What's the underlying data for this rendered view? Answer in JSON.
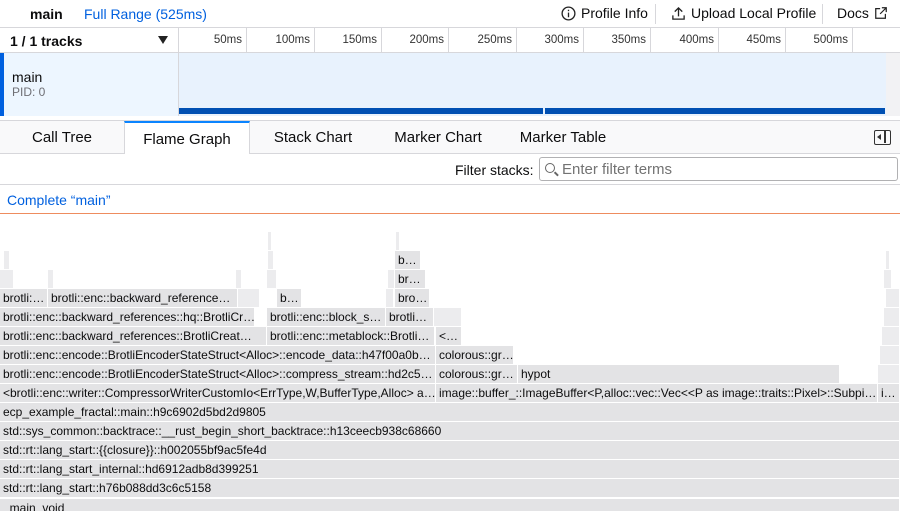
{
  "topbar": {
    "root_crumb": "main",
    "range_crumb": "Full Range (525ms)",
    "profile_info": "Profile Info",
    "upload": "Upload Local Profile",
    "docs": "Docs"
  },
  "timeline": {
    "tracks_label": "1 / 1 tracks",
    "ticks": [
      "50ms",
      "100ms",
      "150ms",
      "200ms",
      "250ms",
      "300ms",
      "350ms",
      "400ms",
      "450ms",
      "500ms"
    ],
    "track": {
      "name": "main",
      "pid": "PID: 0"
    }
  },
  "tabs": [
    "Call Tree",
    "Flame Graph",
    "Stack Chart",
    "Marker Chart",
    "Marker Table"
  ],
  "active_tab": "Flame Graph",
  "filter": {
    "label": "Filter stacks:",
    "placeholder": "Enter filter terms"
  },
  "breadcrumb": "Complete “main”",
  "flame": {
    "rows": [
      [
        "_main_void"
      ],
      [
        "std::rt::lang_start::h76b088dd3c6c5158"
      ],
      [
        "std::rt::lang_start_internal::hd6912adb8d399251"
      ],
      [
        "std::rt::lang_start::{{closure}}::h002055bf9ac5fe4d"
      ],
      [
        "std::sys_common::backtrace::__rust_begin_short_backtrace::h13ceecb938c68660"
      ],
      [
        "ecp_example_fractal::main::h9c6902d5bd2d9805"
      ],
      [
        "<brotli::enc::writer::CompressorWriterCustomIo<ErrType,W,BufferType,Alloc> a…",
        "image::buffer_::ImageBuffer<P,alloc::vec::Vec<<P as image::traits::Pixel>::Subpi…",
        "i…"
      ],
      [
        "brotli::enc::encode::BrotliEncoderStateStruct<Alloc>::compress_stream::hd2c5…",
        "colorous::gr…",
        "hypot"
      ],
      [
        "brotli::enc::encode::BrotliEncoderStateStruct<Alloc>::encode_data::h47f00a0b…",
        "colorous::gr…"
      ],
      [
        "brotli::enc::backward_references::BrotliCreat…",
        "brotli::enc::metablock::Brotli…",
        "<…"
      ],
      [
        "brotli::enc::backward_references::hq::BrotliCr…",
        "brotli::enc::block_s…",
        "brotli…"
      ],
      [
        "brotli:…",
        "brotli::enc::backward_reference…",
        "b…",
        "bro…"
      ],
      [
        "br…"
      ],
      [
        "b…"
      ]
    ]
  }
}
